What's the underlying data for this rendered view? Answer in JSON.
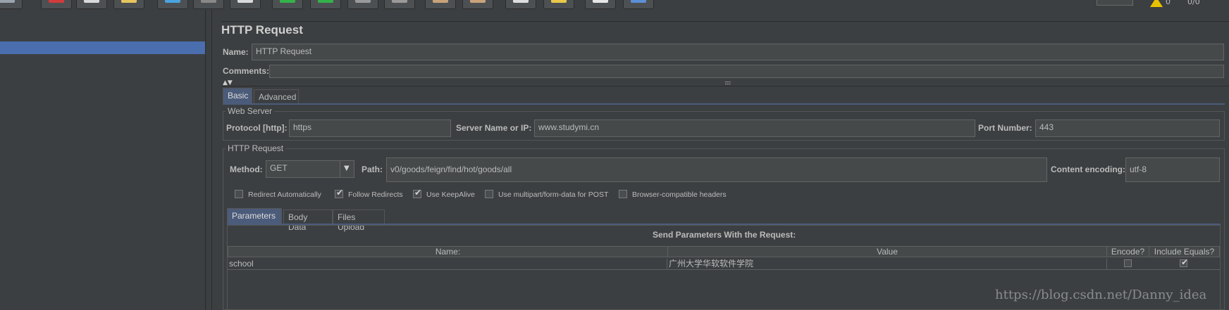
{
  "toolbar": {
    "buttons": [
      {
        "icon": "template-icon",
        "color": "#9aa3ad"
      },
      {
        "icon": "cut-icon",
        "color": "#d23b3b"
      },
      {
        "icon": "copy-icon",
        "color": "#d9d9d9"
      },
      {
        "icon": "paste-icon",
        "color": "#e5c55d"
      },
      {
        "icon": "expand-icon",
        "color": "#4aa3df"
      },
      {
        "icon": "collapse-icon",
        "color": "#888888"
      },
      {
        "icon": "toggle-icon",
        "color": "#d9d9d9"
      },
      {
        "icon": "start-icon",
        "color": "#33b24a"
      },
      {
        "icon": "start-no-pause-icon",
        "color": "#33b24a"
      },
      {
        "icon": "stop-icon",
        "color": "#9a9a9a"
      },
      {
        "icon": "shutdown-icon",
        "color": "#9a9a9a"
      },
      {
        "icon": "clear-icon",
        "color": "#c9a27a"
      },
      {
        "icon": "clear-all-icon",
        "color": "#c9a27a"
      },
      {
        "icon": "search-icon",
        "color": "#dddddd"
      },
      {
        "icon": "reset-search-icon",
        "color": "#e9c84a"
      },
      {
        "icon": "function-helper-icon",
        "color": "#e6e6e6"
      },
      {
        "icon": "help-icon",
        "color": "#5b8fd6"
      }
    ],
    "warning_icon": "warning-icon"
  },
  "panel": {
    "title": "HTTP Request",
    "name_label": "Name:",
    "name_value": "HTTP Request",
    "comments_label": "Comments:",
    "tabs": [
      "Basic",
      "Advanced"
    ],
    "web_server": {
      "title": "Web Server",
      "protocol_label": "Protocol [http]:",
      "protocol_value": "https",
      "server_label": "Server Name or IP:",
      "server_value": "www.studymi.cn",
      "port_label": "Port Number:",
      "port_value": "443"
    },
    "http_request": {
      "title": "HTTP Request",
      "method_label": "Method:",
      "method_value": "GET",
      "path_label": "Path:",
      "path_value": "v0/goods/feign/find/hot/goods/all",
      "encoding_label": "Content encoding:",
      "encoding_value": "utf-8"
    },
    "options": [
      {
        "label": "Redirect Automatically",
        "checked": false
      },
      {
        "label": "Follow Redirects",
        "checked": true
      },
      {
        "label": "Use KeepAlive",
        "checked": true
      },
      {
        "label": "Use multipart/form-data for POST",
        "checked": false
      },
      {
        "label": "Browser-compatible headers",
        "checked": false
      }
    ],
    "param_tabs": [
      "Parameters",
      "Body Data",
      "Files Upload"
    ],
    "params_caption": "Send Parameters With the Request:",
    "columns": [
      "Name:",
      "Value",
      "Encode?",
      "Include Equals?"
    ],
    "rows": [
      {
        "name": "school",
        "value": "广州大学华软软件学院",
        "encode": false,
        "include_equals": true
      }
    ]
  },
  "watermark": "https://blog.csdn.net/Danny_idea"
}
